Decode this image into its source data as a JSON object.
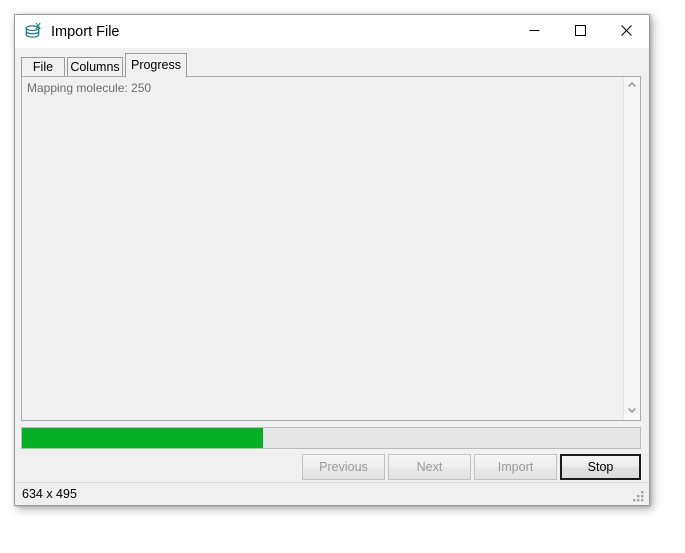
{
  "window": {
    "title": "Import File",
    "icon": "import-file-database-icon",
    "controls": {
      "minimize": "minimize-icon",
      "maximize": "maximize-icon",
      "close": "close-icon"
    }
  },
  "tabs": [
    {
      "id": "file",
      "label": "File",
      "active": false
    },
    {
      "id": "columns",
      "label": "Columns",
      "active": false
    },
    {
      "id": "progress",
      "label": "Progress",
      "active": true
    }
  ],
  "log": {
    "lines": "Mapping molecule: 250"
  },
  "scrollbar": {
    "up_arrow": "chevron-up-icon",
    "down_arrow": "chevron-down-icon"
  },
  "progress": {
    "percent": 39,
    "fill_color": "#06b025",
    "track_color": "#e6e6e6"
  },
  "buttons": {
    "previous": {
      "label": "Previous",
      "enabled": false
    },
    "next": {
      "label": "Next",
      "enabled": false
    },
    "import": {
      "label": "Import",
      "enabled": false
    },
    "stop": {
      "label": "Stop",
      "enabled": true,
      "default": true
    }
  },
  "statusbar": {
    "size_text": "634 x 495",
    "grip": "resize-grip-icon"
  }
}
